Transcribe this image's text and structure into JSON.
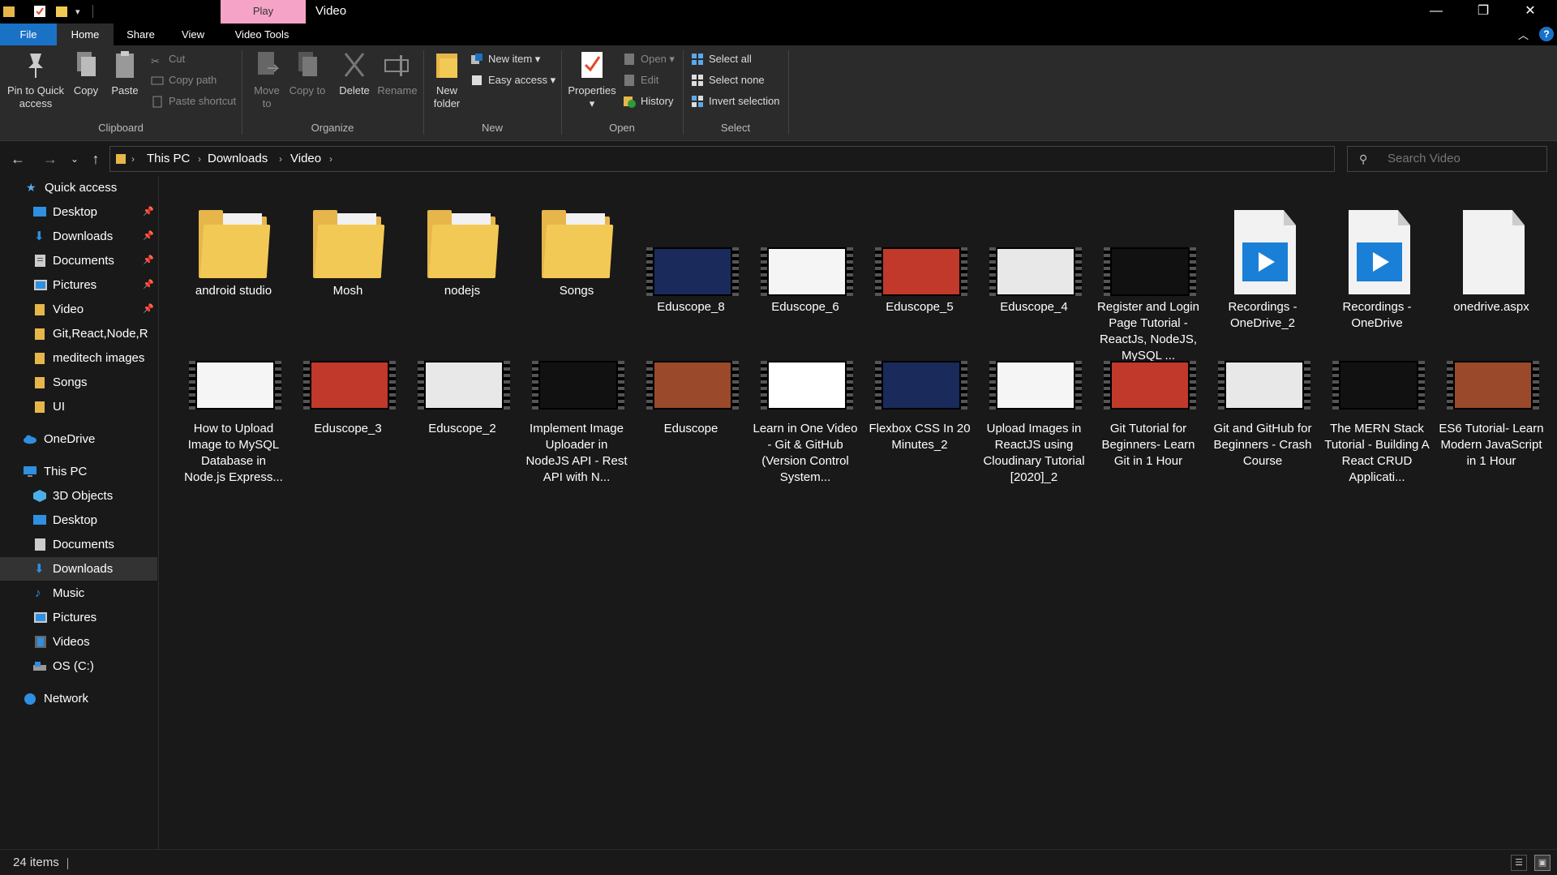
{
  "window": {
    "title": "Video",
    "play_tab": "Play"
  },
  "tabs": {
    "file": "File",
    "home": "Home",
    "share": "Share",
    "view": "View",
    "video_tools": "Video Tools"
  },
  "ribbon": {
    "clipboard": {
      "pin": "Pin to Quick access",
      "copy": "Copy",
      "paste": "Paste",
      "cut": "Cut",
      "copy_path": "Copy path",
      "paste_shortcut": "Paste shortcut",
      "label": "Clipboard"
    },
    "organize": {
      "move_to": "Move to",
      "copy_to": "Copy to",
      "delete": "Delete",
      "rename": "Rename",
      "label": "Organize"
    },
    "new": {
      "new_folder": "New folder",
      "new_item": "New item",
      "easy_access": "Easy access",
      "label": "New"
    },
    "open": {
      "properties": "Properties",
      "open": "Open",
      "edit": "Edit",
      "history": "History",
      "label": "Open"
    },
    "select": {
      "select_all": "Select all",
      "select_none": "Select none",
      "invert": "Invert selection",
      "label": "Select"
    }
  },
  "address": {
    "crumbs": [
      "This PC",
      "Downloads",
      "Video"
    ]
  },
  "search": {
    "placeholder": "Search Video"
  },
  "sidebar": {
    "quick_access": "Quick access",
    "quick": [
      "Desktop",
      "Downloads",
      "Documents",
      "Pictures",
      "Video",
      "Git,React,Node,R",
      "meditech images",
      "Songs",
      "UI"
    ],
    "onedrive": "OneDrive",
    "this_pc": "This PC",
    "pc": [
      "3D Objects",
      "Desktop",
      "Documents",
      "Downloads",
      "Music",
      "Pictures",
      "Videos",
      "OS (C:)"
    ],
    "network": "Network"
  },
  "items": [
    {
      "name": "android studio",
      "kind": "folder"
    },
    {
      "name": "Mosh",
      "kind": "folder"
    },
    {
      "name": "nodejs",
      "kind": "folder"
    },
    {
      "name": "Songs",
      "kind": "folder"
    },
    {
      "name": "Eduscope_8",
      "kind": "video"
    },
    {
      "name": "Eduscope_6",
      "kind": "video"
    },
    {
      "name": "Eduscope_5",
      "kind": "video"
    },
    {
      "name": "Eduscope_4",
      "kind": "video"
    },
    {
      "name": "Register and Login Page Tutorial - ReactJs, NodeJS, MySQL ...",
      "kind": "video"
    },
    {
      "name": "Recordings - OneDrive_2",
      "kind": "doc"
    },
    {
      "name": "Recordings - OneDrive",
      "kind": "doc"
    },
    {
      "name": "onedrive.aspx",
      "kind": "blank"
    },
    {
      "name": "How to Upload Image to MySQL Database in Node.js Express...",
      "kind": "video"
    },
    {
      "name": "Eduscope_3",
      "kind": "video"
    },
    {
      "name": "Eduscope_2",
      "kind": "video"
    },
    {
      "name": "Implement Image Uploader in NodeJS API - Rest API with N...",
      "kind": "video"
    },
    {
      "name": "Eduscope",
      "kind": "video"
    },
    {
      "name": "Learn in One Video - Git & GitHub (Version Control System...",
      "kind": "video"
    },
    {
      "name": "Flexbox CSS In 20 Minutes_2",
      "kind": "video"
    },
    {
      "name": "Upload Images in ReactJS using Cloudinary Tutorial [2020]_2",
      "kind": "video"
    },
    {
      "name": "Git Tutorial for Beginners- Learn Git in 1 Hour",
      "kind": "video"
    },
    {
      "name": "Git and GitHub for Beginners - Crash Course",
      "kind": "video"
    },
    {
      "name": "The MERN Stack Tutorial - Building A React CRUD Applicati...",
      "kind": "video"
    },
    {
      "name": "ES6 Tutorial- Learn Modern JavaScript in 1 Hour",
      "kind": "video"
    }
  ],
  "status": {
    "count": "24 items"
  },
  "colors": {
    "accent": "#1a72c6",
    "folder": "#e7b64b",
    "play_tab": "#f5a4c7"
  }
}
